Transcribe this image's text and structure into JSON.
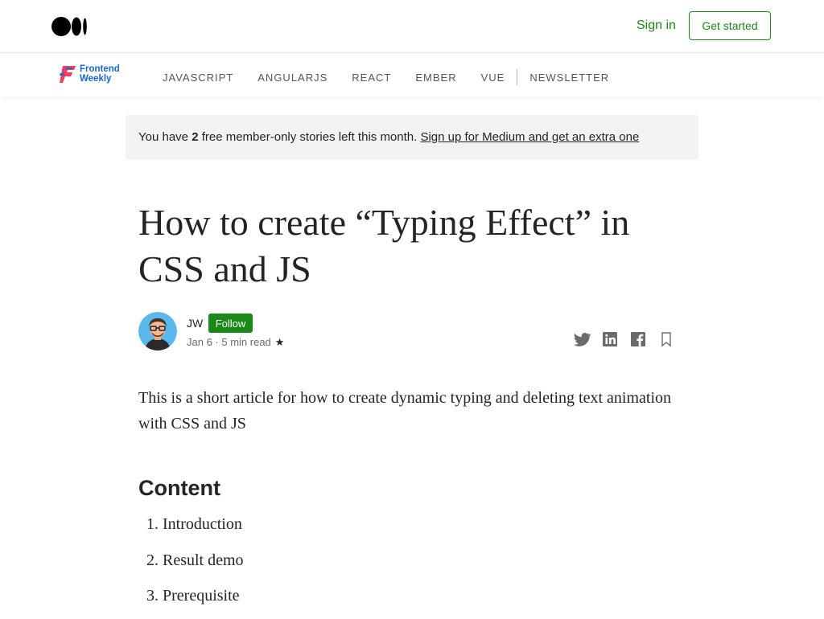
{
  "header": {
    "sign_in": "Sign in",
    "get_started": "Get started",
    "accent_color": "#1a8917"
  },
  "publication": {
    "logo_line1": "Frontend",
    "logo_line2": "Weekly",
    "nav": [
      "JAVASCRIPT",
      "ANGULARJS",
      "REACT",
      "EMBER",
      "VUE",
      "NEWSLETTER"
    ]
  },
  "banner": {
    "prefix": "You have ",
    "count": "2",
    "suffix": " free member-only stories left this month. ",
    "link": "Sign up for Medium and get an extra one"
  },
  "article": {
    "title": "How to create “Typing Effect” in CSS and JS",
    "author": "JW",
    "follow": "Follow",
    "meta": "Jan 6 · 5 min read",
    "star": "★",
    "intro": "This is a short article for how to create dynamic typing and deleting text animation with CSS and JS",
    "content_heading": "Content",
    "toc": [
      "Introduction",
      "Result demo",
      "Prerequisite"
    ]
  },
  "icons": [
    "medium-logo",
    "frontend-weekly-logo",
    "twitter-icon",
    "linkedin-icon",
    "facebook-icon",
    "bookmark-icon"
  ]
}
